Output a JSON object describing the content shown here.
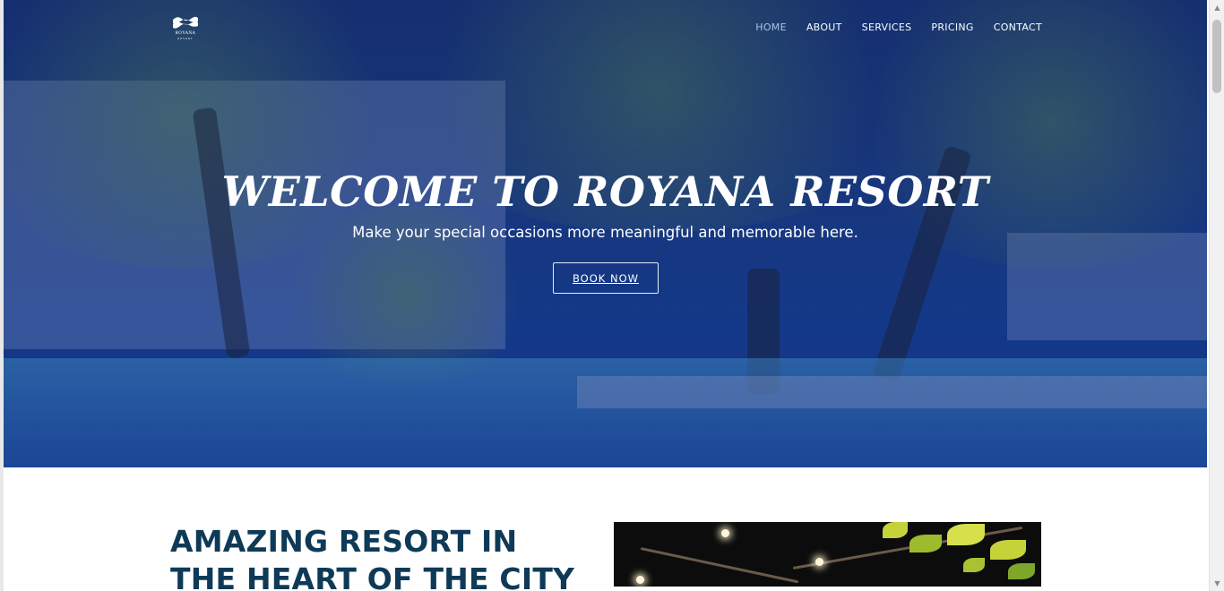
{
  "brand": {
    "name": "ROYANA",
    "tagline": "RESORT"
  },
  "nav": {
    "items": [
      {
        "label": "HOME",
        "active": true
      },
      {
        "label": "ABOUT",
        "active": false
      },
      {
        "label": "SERVICES",
        "active": false
      },
      {
        "label": "PRICING",
        "active": false
      },
      {
        "label": "CONTACT",
        "active": false
      }
    ]
  },
  "hero": {
    "title": "WELCOME TO ROYANA RESORT",
    "subtitle": "Make your special occasions more meaningful and memorable here.",
    "cta_label": "BOOK NOW"
  },
  "about": {
    "heading": "AMAZING RESORT IN THE HEART OF THE CITY"
  },
  "colors": {
    "overlay": "#1d3d7a",
    "nav_active": "#a9c4ea",
    "heading": "#0e3a57"
  }
}
